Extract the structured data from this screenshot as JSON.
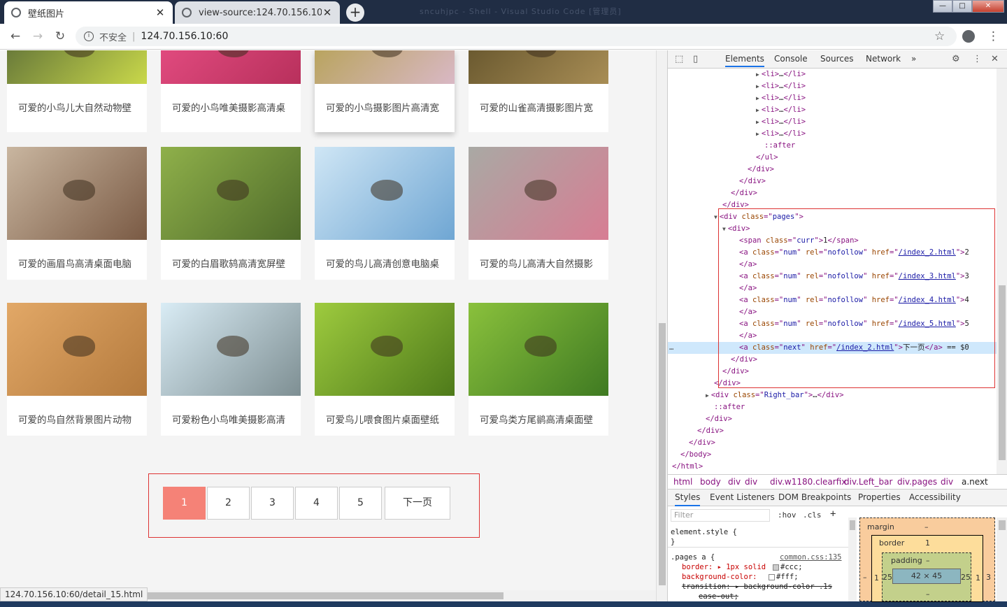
{
  "browser": {
    "tabs": [
      {
        "title": "壁纸图片",
        "close": "✕"
      },
      {
        "title": "view-source:124.70.156.10:60",
        "close": "✕"
      }
    ],
    "new_tab": "+",
    "window_buttons": {
      "minimize": "—",
      "maximize": "□",
      "close": "✕"
    },
    "background_title": "sncuhjpc - Shell - Visual Studio Code [管理员]",
    "nav": {
      "back": "←",
      "forward": "→",
      "reload": "↻"
    },
    "security_label": "不安全",
    "url": "124.70.156.10:60",
    "star": "☆",
    "menu": "⋮",
    "status_url": "124.70.156.10:60/detail_15.html"
  },
  "gallery": {
    "top_row": [
      {
        "caption": "可爱的小鸟儿大自然动物壁",
        "colors": [
          "#6a7b3a",
          "#c9d84a"
        ]
      },
      {
        "caption": "可爱的小鸟唯美摄影高清桌",
        "colors": [
          "#e04a7e",
          "#b8305c"
        ]
      },
      {
        "caption": "可爱的小鸟摄影图片高清宽",
        "colors": [
          "#b9a45f",
          "#d9b8c5"
        ]
      },
      {
        "caption": "可爱的山雀高清摄影图片宽",
        "colors": [
          "#6b5a30",
          "#a88d55"
        ]
      }
    ],
    "rows": [
      [
        {
          "caption": "可爱的画眉鸟高清桌面电脑",
          "colors": [
            "#c9b6a0",
            "#7a5a44"
          ]
        },
        {
          "caption": "可爱的白眉歌鸫高清宽屏壁",
          "colors": [
            "#8fb04a",
            "#4f6b2a"
          ]
        },
        {
          "caption": "可爱的鸟儿高清创意电脑桌",
          "colors": [
            "#cfe6f5",
            "#6fa6d3"
          ]
        },
        {
          "caption": "可爱的鸟儿高清大自然摄影",
          "colors": [
            "#a9a9a4",
            "#d77d93"
          ]
        }
      ],
      [
        {
          "caption": "可爱的鸟自然背景图片动物",
          "colors": [
            "#e2a867",
            "#b47a3d"
          ]
        },
        {
          "caption": "可爱粉色小鸟唯美摄影高清",
          "colors": [
            "#d9ecf5",
            "#7e8f93"
          ]
        },
        {
          "caption": "可爱鸟儿喂食图片桌面壁纸",
          "colors": [
            "#9ecb3e",
            "#4e7a1a"
          ]
        },
        {
          "caption": "可爱鸟类方尾鹟高清桌面壁",
          "colors": [
            "#8ac13c",
            "#3f7a22"
          ]
        }
      ]
    ]
  },
  "pagination": {
    "pages": [
      "1",
      "2",
      "3",
      "4",
      "5"
    ],
    "current": "1",
    "next": "下一页",
    "accent": "#f58277"
  },
  "devtools": {
    "tabs": [
      "Elements",
      "Console",
      "Sources",
      "Network",
      "»"
    ],
    "icons": {
      "inspect": "⬚",
      "device": "▯",
      "settings": "⚙",
      "more": "⋮",
      "close": "✕"
    },
    "tree": [
      {
        "indent": 11,
        "parts": [
          [
            "tri",
            "▶"
          ],
          [
            "tag",
            "<li>"
          ],
          [
            "tx",
            "…"
          ],
          [
            "tag",
            "</li>"
          ]
        ]
      },
      {
        "indent": 11,
        "parts": [
          [
            "tri",
            "▶"
          ],
          [
            "tag",
            "<li>"
          ],
          [
            "tx",
            "…"
          ],
          [
            "tag",
            "</li>"
          ]
        ]
      },
      {
        "indent": 11,
        "parts": [
          [
            "tri",
            "▶"
          ],
          [
            "tag",
            "<li>"
          ],
          [
            "tx",
            "…"
          ],
          [
            "tag",
            "</li>"
          ]
        ]
      },
      {
        "indent": 11,
        "parts": [
          [
            "tri",
            "▶"
          ],
          [
            "tag",
            "<li>"
          ],
          [
            "tx",
            "…"
          ],
          [
            "tag",
            "</li>"
          ]
        ]
      },
      {
        "indent": 11,
        "parts": [
          [
            "tri",
            "▶"
          ],
          [
            "tag",
            "<li>"
          ],
          [
            "tx",
            "…"
          ],
          [
            "tag",
            "</li>"
          ]
        ]
      },
      {
        "indent": 11,
        "parts": [
          [
            "tri",
            "▶"
          ],
          [
            "tag",
            "<li>"
          ],
          [
            "tx",
            "…"
          ],
          [
            "tag",
            "</li>"
          ]
        ]
      },
      {
        "indent": 12,
        "parts": [
          [
            "tag",
            "::after"
          ]
        ]
      },
      {
        "indent": 11,
        "parts": [
          [
            "tag",
            "</ul>"
          ]
        ]
      },
      {
        "indent": 10,
        "parts": [
          [
            "tag",
            "</div>"
          ]
        ]
      },
      {
        "indent": 9,
        "parts": [
          [
            "tag",
            "</div>"
          ]
        ]
      },
      {
        "indent": 8,
        "parts": [
          [
            "tag",
            "</div>"
          ]
        ]
      },
      {
        "indent": 7,
        "parts": [
          [
            "tag",
            "</div>"
          ]
        ]
      },
      {
        "indent": 6,
        "parts": [
          [
            "tri",
            "▼"
          ],
          [
            "tag",
            "<div "
          ],
          [
            "at",
            "class"
          ],
          [
            "tag",
            "=\""
          ],
          [
            "av",
            "pages"
          ],
          [
            "tag",
            "\">"
          ]
        ]
      },
      {
        "indent": 7,
        "parts": [
          [
            "tri",
            "▼"
          ],
          [
            "tag",
            "<div>"
          ]
        ]
      },
      {
        "indent": 9,
        "parts": [
          [
            "tag",
            "<span "
          ],
          [
            "at",
            "class"
          ],
          [
            "tag",
            "=\""
          ],
          [
            "av",
            "curr"
          ],
          [
            "tag",
            "\">"
          ],
          [
            "tx",
            "1"
          ],
          [
            "tag",
            "</span>"
          ]
        ]
      },
      {
        "indent": 9,
        "parts": [
          [
            "tag",
            "<a "
          ],
          [
            "at",
            "class"
          ],
          [
            "tag",
            "=\""
          ],
          [
            "av",
            "num"
          ],
          [
            "tag",
            "\" "
          ],
          [
            "at",
            "rel"
          ],
          [
            "tag",
            "=\""
          ],
          [
            "av",
            "nofollow"
          ],
          [
            "tag",
            "\" "
          ],
          [
            "at",
            "href"
          ],
          [
            "tag",
            "=\""
          ],
          [
            "lk",
            "/index_2.html"
          ],
          [
            "tag",
            "\">"
          ],
          [
            "tx",
            "2"
          ]
        ]
      },
      {
        "indent": 9,
        "parts": [
          [
            "tag",
            "</a>"
          ]
        ]
      },
      {
        "indent": 9,
        "parts": [
          [
            "tag",
            "<a "
          ],
          [
            "at",
            "class"
          ],
          [
            "tag",
            "=\""
          ],
          [
            "av",
            "num"
          ],
          [
            "tag",
            "\" "
          ],
          [
            "at",
            "rel"
          ],
          [
            "tag",
            "=\""
          ],
          [
            "av",
            "nofollow"
          ],
          [
            "tag",
            "\" "
          ],
          [
            "at",
            "href"
          ],
          [
            "tag",
            "=\""
          ],
          [
            "lk",
            "/index_3.html"
          ],
          [
            "tag",
            "\">"
          ],
          [
            "tx",
            "3"
          ]
        ]
      },
      {
        "indent": 9,
        "parts": [
          [
            "tag",
            "</a>"
          ]
        ]
      },
      {
        "indent": 9,
        "parts": [
          [
            "tag",
            "<a "
          ],
          [
            "at",
            "class"
          ],
          [
            "tag",
            "=\""
          ],
          [
            "av",
            "num"
          ],
          [
            "tag",
            "\" "
          ],
          [
            "at",
            "rel"
          ],
          [
            "tag",
            "=\""
          ],
          [
            "av",
            "nofollow"
          ],
          [
            "tag",
            "\" "
          ],
          [
            "at",
            "href"
          ],
          [
            "tag",
            "=\""
          ],
          [
            "lk",
            "/index_4.html"
          ],
          [
            "tag",
            "\">"
          ],
          [
            "tx",
            "4"
          ]
        ]
      },
      {
        "indent": 9,
        "parts": [
          [
            "tag",
            "</a>"
          ]
        ]
      },
      {
        "indent": 9,
        "parts": [
          [
            "tag",
            "<a "
          ],
          [
            "at",
            "class"
          ],
          [
            "tag",
            "=\""
          ],
          [
            "av",
            "num"
          ],
          [
            "tag",
            "\" "
          ],
          [
            "at",
            "rel"
          ],
          [
            "tag",
            "=\""
          ],
          [
            "av",
            "nofollow"
          ],
          [
            "tag",
            "\" "
          ],
          [
            "at",
            "href"
          ],
          [
            "tag",
            "=\""
          ],
          [
            "lk",
            "/index_5.html"
          ],
          [
            "tag",
            "\">"
          ],
          [
            "tx",
            "5"
          ]
        ]
      },
      {
        "indent": 9,
        "parts": [
          [
            "tag",
            "</a>"
          ]
        ]
      },
      {
        "indent": 9,
        "parts": [
          [
            "tag",
            "<a "
          ],
          [
            "at",
            "class"
          ],
          [
            "tag",
            "=\""
          ],
          [
            "av",
            "next"
          ],
          [
            "tag",
            "\" "
          ],
          [
            "at",
            "href"
          ],
          [
            "tag",
            "=\""
          ],
          [
            "lk",
            "/index_2.html"
          ],
          [
            "tag",
            "\">"
          ],
          [
            "tx",
            "下一页"
          ],
          [
            "tag",
            "</a>"
          ],
          [
            "tx",
            " == $0"
          ]
        ]
      },
      {
        "indent": 8,
        "parts": [
          [
            "tag",
            "</div>"
          ]
        ]
      },
      {
        "indent": 7,
        "parts": [
          [
            "tag",
            "</div>"
          ]
        ]
      },
      {
        "indent": 6,
        "parts": [
          [
            "tag",
            "</div>"
          ]
        ]
      },
      {
        "indent": 5,
        "parts": [
          [
            "tri",
            "▶"
          ],
          [
            "tag",
            "<div "
          ],
          [
            "at",
            "class"
          ],
          [
            "tag",
            "=\""
          ],
          [
            "av",
            "Right_bar"
          ],
          [
            "tag",
            "\">"
          ],
          [
            "tx",
            "…"
          ],
          [
            "tag",
            "</div>"
          ]
        ]
      },
      {
        "indent": 6,
        "parts": [
          [
            "tag",
            "::after"
          ]
        ]
      },
      {
        "indent": 5,
        "parts": [
          [
            "tag",
            "</div>"
          ]
        ]
      },
      {
        "indent": 4,
        "parts": [
          [
            "tag",
            "</div>"
          ]
        ]
      },
      {
        "indent": 3,
        "parts": [
          [
            "tag",
            "</div>"
          ]
        ]
      },
      {
        "indent": 2,
        "parts": [
          [
            "tag",
            "</body>"
          ]
        ]
      },
      {
        "indent": 1,
        "parts": [
          [
            "tag",
            "</html>"
          ]
        ]
      }
    ],
    "selected_marker": "…",
    "breadcrumbs": [
      "html",
      "body",
      "div",
      "div",
      "div.w1180.clearfix",
      "div.Left_bar",
      "div.pages",
      "div",
      "a.next"
    ],
    "style_tabs": [
      "Styles",
      "Event Listeners",
      "DOM Breakpoints",
      "Properties",
      "Accessibility"
    ],
    "filter_placeholder": "Filter",
    "hov": ":hov",
    "cls": ".cls",
    "add_rule": "+",
    "rules": {
      "element_style": "element.style {",
      "close_brace": "}",
      "selector": ".pages a {",
      "source": "common.css:135",
      "border": "border: ▸ 1px solid",
      "border_color": "#ccc;",
      "background": "background-color:",
      "bg_color": "#fff;",
      "transition": "transition: ▸ background-color .1s",
      "ease": "ease-out;"
    },
    "box_model": {
      "margin": "margin",
      "margin_val": "–",
      "border": "border",
      "border_val": "1",
      "padding": "padding",
      "padding_val": "–",
      "content": "42 × 45",
      "pad_left": "25",
      "pad_right": "25",
      "border_left": "1",
      "border_right": "1",
      "margin_left": "–",
      "margin_right": "3",
      "pad_bottom": "–"
    }
  }
}
